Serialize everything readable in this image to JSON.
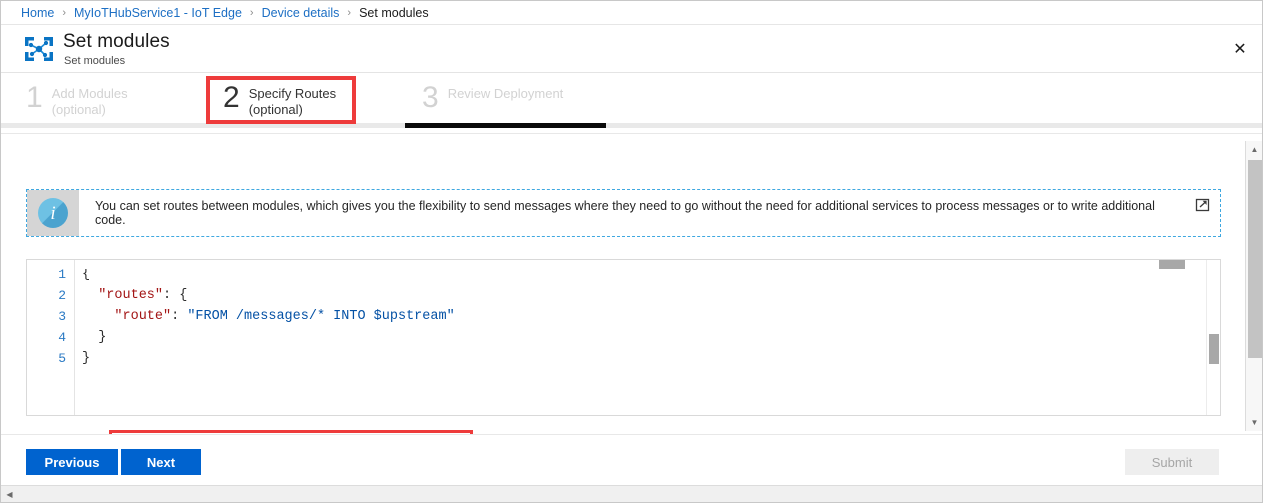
{
  "breadcrumb": {
    "separator": "›",
    "items": [
      {
        "label": "Home",
        "current": false
      },
      {
        "label": "MyIoTHubService1 - IoT Edge",
        "current": false
      },
      {
        "label": "Device details",
        "current": false
      },
      {
        "label": "Set modules",
        "current": true
      }
    ]
  },
  "header": {
    "icon": "iot-edge-icon",
    "title": "Set modules",
    "subtitle": "Set modules",
    "close_label": "✕"
  },
  "steps": [
    {
      "number": "1",
      "label": "Add Modules",
      "optional": "(optional)",
      "active": false
    },
    {
      "number": "2",
      "label": "Specify Routes",
      "optional": "(optional)",
      "active": true
    },
    {
      "number": "3",
      "label": "Review Deployment",
      "optional": "",
      "active": false
    }
  ],
  "info_banner": {
    "icon": "info-icon",
    "text": "You can set routes between modules, which gives you the flexibility to send messages where they need to go without the need for additional services to process messages or to write additional code.",
    "external_link_icon": "external-link-icon"
  },
  "editor": {
    "line_numbers": [
      "1",
      "2",
      "3",
      "4",
      "5"
    ],
    "lines": [
      {
        "indent": "",
        "segments": [
          {
            "text": "{",
            "type": "punc"
          }
        ]
      },
      {
        "indent": "  ",
        "segments": [
          {
            "text": "\"routes\"",
            "type": "key"
          },
          {
            "text": ": {",
            "type": "punc"
          }
        ]
      },
      {
        "indent": "    ",
        "segments": [
          {
            "text": "\"route\"",
            "type": "key"
          },
          {
            "text": ": ",
            "type": "punc"
          },
          {
            "text": "\"FROM /messages/* INTO $upstream\"",
            "type": "str"
          }
        ]
      },
      {
        "indent": "  ",
        "segments": [
          {
            "text": "}",
            "type": "punc"
          }
        ]
      },
      {
        "indent": "",
        "segments": [
          {
            "text": "}",
            "type": "punc"
          }
        ]
      }
    ]
  },
  "footer": {
    "previous_label": "Previous",
    "next_label": "Next",
    "submit_label": "Submit"
  },
  "annotations": [
    {
      "name": "step-2-highlight",
      "color": "#ee3b3b"
    },
    {
      "name": "route-line-highlight",
      "color": "#ee3b3b"
    }
  ],
  "colors": {
    "accent_blue": "#0063cf",
    "link_blue": "#1d6fc4",
    "annotation_red": "#ee3b3b",
    "json_key": "#a31515",
    "json_string": "#0451a5",
    "line_number": "#2b7ac4"
  }
}
